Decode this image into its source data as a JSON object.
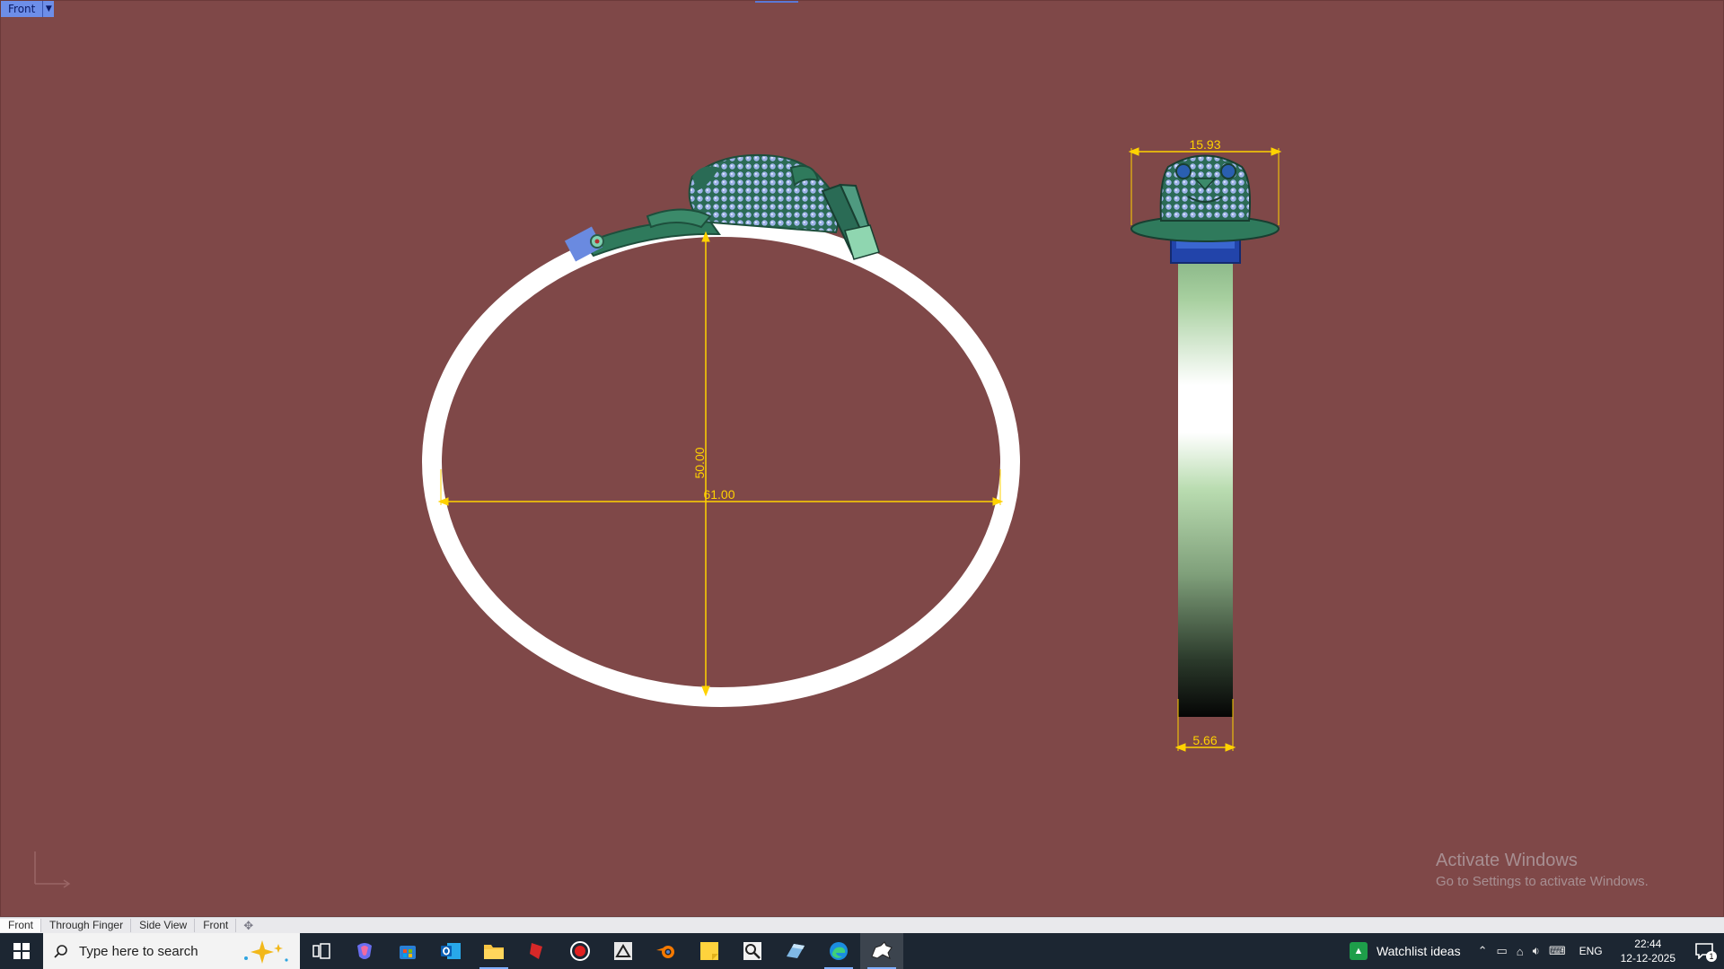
{
  "viewport": {
    "label": "Front",
    "dropdown_icon": "caret-down-icon",
    "background": "#7f4848"
  },
  "dimensions": {
    "width_outer": "61.00",
    "height_outer": "50.00",
    "head_width": "15.93",
    "band_width": "5.66",
    "dim_color": "#ffd200"
  },
  "watermark": {
    "line1": "Activate Windows",
    "line2": "Go to Settings to activate Windows."
  },
  "view_tabs": [
    {
      "label": "Front",
      "active": true
    },
    {
      "label": "Through Finger",
      "active": false
    },
    {
      "label": "Side View",
      "active": false
    },
    {
      "label": "Front",
      "active": false
    }
  ],
  "taskbar": {
    "search_placeholder": "Type here to search",
    "apps": [
      "task-view-icon",
      "copilot-icon",
      "store-icon",
      "outlook-icon",
      "file-explorer-icon",
      "red-app-icon",
      "recorder-icon",
      "zbrush-icon",
      "blender-icon",
      "sticky-notes-icon",
      "magnifier-icon",
      "matrix-icon",
      "edge-icon",
      "rhino-icon"
    ],
    "watchlist_label": "Watchlist ideas",
    "language": "ENG",
    "time": "22:44",
    "date": "12-12-2025",
    "notification_count": "1"
  }
}
